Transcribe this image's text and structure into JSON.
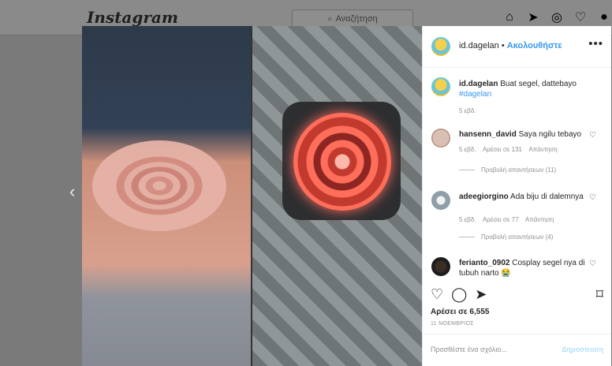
{
  "app": {
    "logo": "Instagram"
  },
  "search": {
    "placeholder": "Αναζήτηση"
  },
  "nav": {
    "icons": [
      "home-icon",
      "direct-icon",
      "explore-icon",
      "activity-icon",
      "profile-icon"
    ]
  },
  "post": {
    "username": "id.dagelan",
    "follow_text": "Ακολουθήστε",
    "caption": "Buat segel, dattebayo",
    "hashtag": "#dagelan",
    "caption_time": "5 εβδ.",
    "likes": "Αρέσει σε 6,555",
    "date": "11 ΝΟΕΜΒΡΙΟΣ",
    "comment_placeholder": "Προσθέστε ένα σχόλιο...",
    "post_label": "Δημοσίευση",
    "more_label": "•••"
  },
  "comments": [
    {
      "username": "hansenn_david",
      "text": "Saya ngilu tebayo",
      "time": "5 εβδ.",
      "likes": "Αρέσει σε 131",
      "reply": "Απάντηση",
      "replies": "Προβολή απαντήσεων (11)"
    },
    {
      "username": "adeegiorgino",
      "text": "Ada biju di dalemnya",
      "time": "5 εβδ.",
      "likes": "Αρέσει σε 77",
      "reply": "Απάντηση",
      "replies": "Προβολή απαντήσεων (4)"
    },
    {
      "username": "ferianto_0902",
      "text": "Cosplay segel nya di tubuh narto 😭"
    }
  ],
  "colors": {
    "accent": "#3897f0",
    "muted": "#8e8e8e",
    "text": "#262626"
  }
}
